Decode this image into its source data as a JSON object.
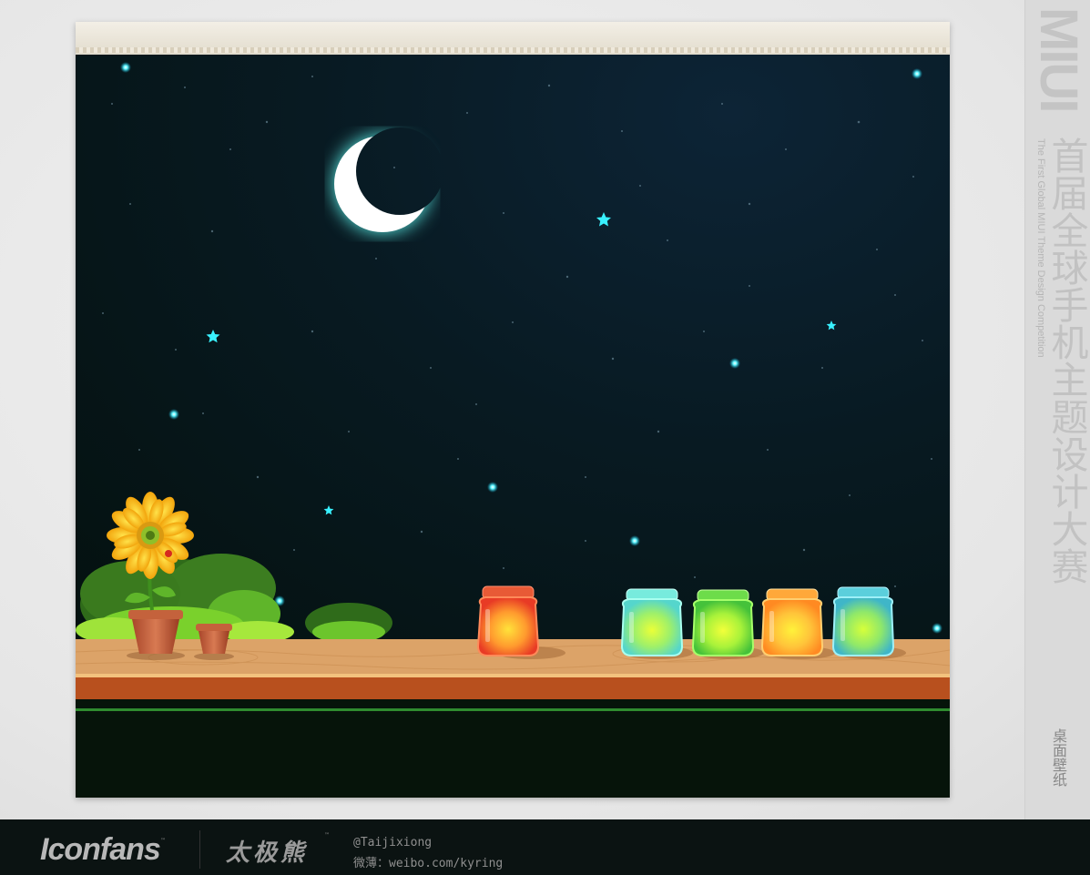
{
  "branding": {
    "miui_logo": "MIUI",
    "competition_en": "The First Global MIUI Theme Design Competition",
    "competition_cn": "首届全球手机主题设计大赛",
    "category": "桌面壁纸"
  },
  "footer": {
    "site_logo": "Iconfans",
    "brand": "太极熊",
    "handle": "@Taijixiong",
    "weibo": "微薄：weibo.com/kyring"
  },
  "scene": {
    "jars": [
      {
        "name": "red",
        "body": "#f14a2c",
        "glow": "#ffd23a"
      },
      {
        "name": "cyan",
        "body": "#6fe6da",
        "glow": "#d8ff3a"
      },
      {
        "name": "green",
        "body": "#63d84a",
        "glow": "#e8ff3a"
      },
      {
        "name": "orange",
        "body": "#ff9b2a",
        "glow": "#fff03a"
      },
      {
        "name": "teal",
        "body": "#4fc9d3",
        "glow": "#c8ff3a"
      }
    ],
    "colors": {
      "sky": "#06161a",
      "moon": "#ffffff",
      "star": "#39f1ff",
      "shelf": "#dca368",
      "shelf_front": "#b8501e",
      "ground": "#06140a"
    },
    "icons": [
      "moon-icon",
      "star-icon",
      "sunflower-icon",
      "flowerpot-icon",
      "jar-icon",
      "bush-icon"
    ]
  }
}
